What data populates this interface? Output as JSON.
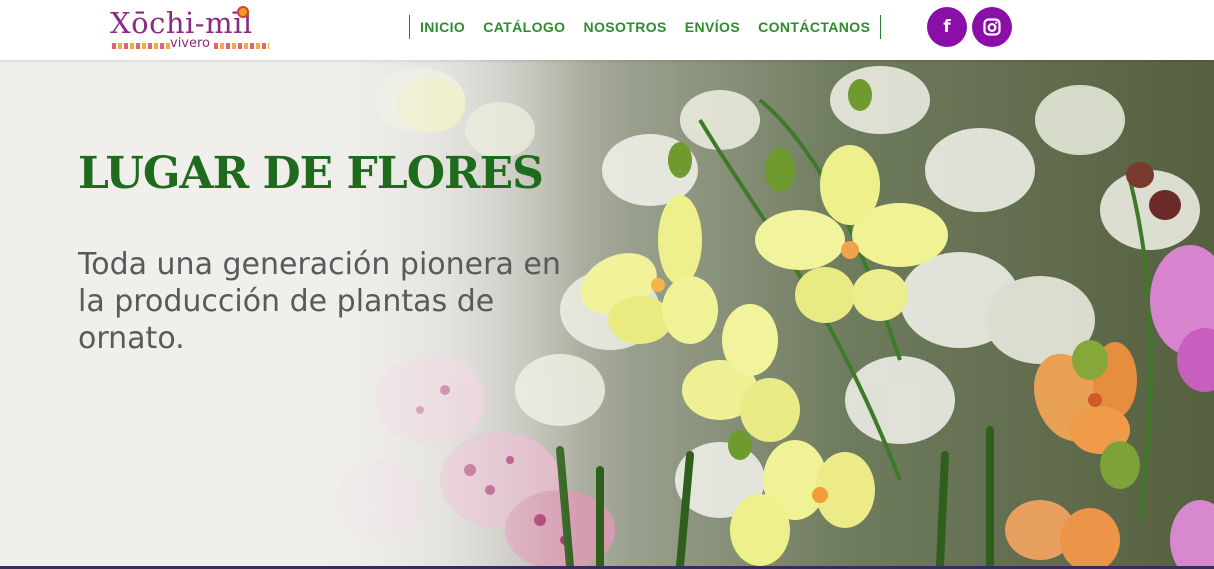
{
  "brand": {
    "name": "Xōchi-mīl",
    "subtitle": "vivero",
    "primary_color": "#8a2a82"
  },
  "nav": {
    "items": [
      {
        "label": "INICIO"
      },
      {
        "label": "CATÁLOGO"
      },
      {
        "label": "NOSOTROS"
      },
      {
        "label": "ENVÍOS"
      },
      {
        "label": "CONTÁCTANOS"
      }
    ],
    "color": "#2e8b2e"
  },
  "social": {
    "facebook": {
      "glyph": "f",
      "icon": "facebook-icon"
    },
    "instagram": {
      "icon": "instagram-icon"
    },
    "color": "#8a0fa8"
  },
  "hero": {
    "title": "LUGAR DE FLORES",
    "subtitle": "Toda una generación pionera en la producción de plantas de ornato.",
    "image": "orchid-flowers-photo"
  }
}
